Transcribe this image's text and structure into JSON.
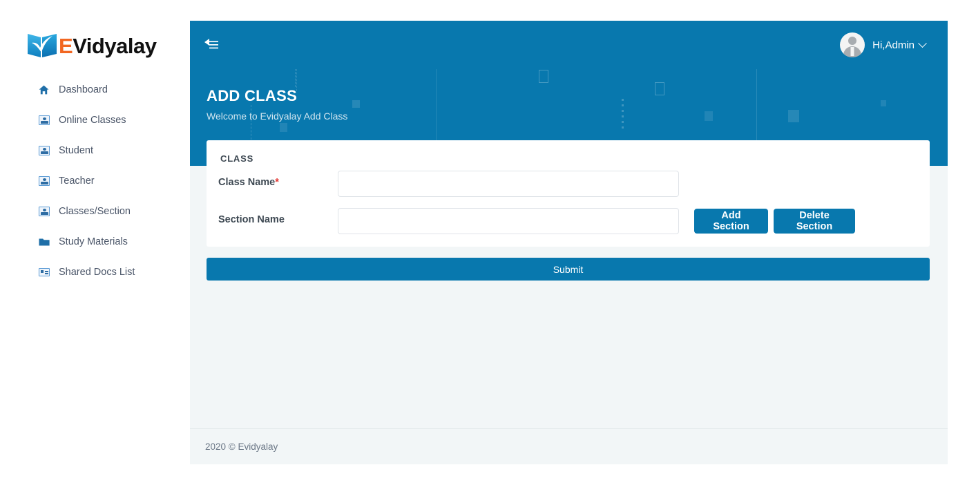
{
  "brand": {
    "logo_icon": "open-book-icon",
    "name_accent": "E",
    "name_rest": "Vidyalay",
    "accent_color": "#F26722",
    "book_color": "#1B9BD8"
  },
  "sidebar": {
    "items": [
      {
        "label": "Dashboard",
        "icon": "home-icon"
      },
      {
        "label": "Online Classes",
        "icon": "broken-image-icon"
      },
      {
        "label": "Student",
        "icon": "broken-image-icon"
      },
      {
        "label": "Teacher",
        "icon": "broken-image-icon"
      },
      {
        "label": "Classes/Section",
        "icon": "broken-image-icon"
      },
      {
        "label": "Study Materials",
        "icon": "folder-icon"
      },
      {
        "label": "Shared Docs List",
        "icon": "broken-doc-icon"
      }
    ]
  },
  "topbar": {
    "collapse_icon": "menu-collapse-left-icon",
    "user_name": "Hi,Admin",
    "avatar_icon": "user-avatar-icon",
    "chevron_icon": "chevron-down-icon",
    "background_color": "#0878AE"
  },
  "banner": {
    "title": "ADD CLASS",
    "subtitle": "Welcome to Evidyalay Add Class"
  },
  "card": {
    "title": "CLASS",
    "fields": [
      {
        "label": "Class Name",
        "required": true,
        "required_marker": "*",
        "value": "",
        "placeholder": ""
      },
      {
        "label": "Section Name",
        "required": false,
        "required_marker": "",
        "value": "",
        "placeholder": ""
      }
    ],
    "add_section_label": "Add Section",
    "delete_section_label": "Delete Section"
  },
  "submit": {
    "label": "Submit"
  },
  "footer": {
    "text": "2020 © Evidyalay"
  }
}
